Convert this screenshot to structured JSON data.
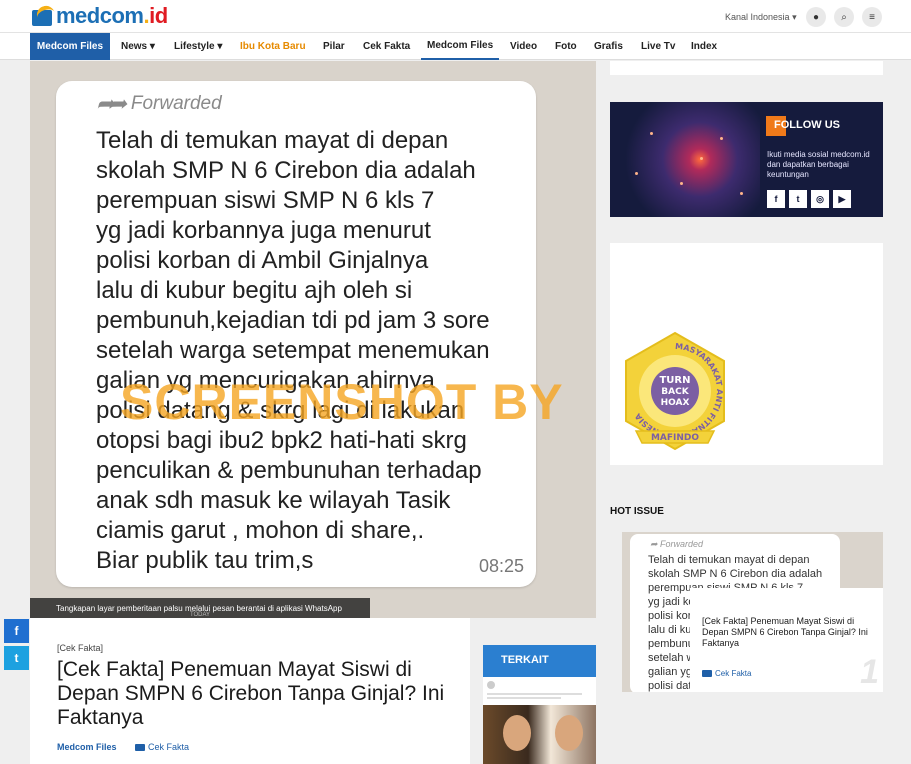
{
  "header": {
    "logo_main": "medcom",
    "logo_dot": ".",
    "logo_tld": "id",
    "kanal_label": "Kanal Indonesia",
    "icons": [
      "user-icon",
      "search-icon",
      "menu-icon"
    ]
  },
  "nav": {
    "active": "Medcom Files",
    "items": [
      "News",
      "Lifestyle",
      "Ibu Kota Baru",
      "Pilar",
      "Cek Fakta",
      "Medcom Files",
      "Video",
      "Foto",
      "Grafis",
      "Live Tv",
      "Index"
    ]
  },
  "hero": {
    "forwarded_label": "Forwarded",
    "message_lines": [
      "Telah di temukan mayat di depan",
      "skolah SMP N 6 Cirebon dia adalah",
      "perempuan siswi SMP N 6 kls 7",
      "yg jadi korbannya juga menurut",
      "polisi korban di Ambil Ginjalnya",
      "lalu di kubur begitu ajh oleh si",
      "pembunuh,kejadian tdi pd jam 3 sore",
      "setelah warga setempat menemukan",
      "galian yg mencurigakan ahirnya",
      "polisi datang & skrg lagi di lakukan",
      "otopsi bagi ibu2 bpk2 hati-hati skrg",
      "penculikan & pembunuhan terhadap",
      "anak sdh masuk ke wilayah Tasik",
      "ciamis garut , mohon di share,.",
      "Biar publik tau trim,s"
    ],
    "time": "08:25",
    "watermark": "SCREENSHOT BY",
    "caption": "Tangkapan layar pemberitaan palsu melalui pesan berantai di aplikasi WhatsApp",
    "caption_tail": "TODAY"
  },
  "share": {
    "facebook": "f",
    "twitter": "t"
  },
  "article": {
    "kicker": "[Cek Fakta]",
    "title": "[Cek Fakta] Penemuan Mayat Siswi di Depan SMPN 6 Cirebon Tanpa Ginjal? Ini Faktanya",
    "author": "Medcom Files",
    "category": "Cek Fakta"
  },
  "terkait": {
    "label": "TERKAIT"
  },
  "sidebar": {
    "follow_title": "FOLLOW US",
    "follow_text": "Ikuti media sosial medcom.id dan dapatkan berbagai keuntungan",
    "follow_buttons": [
      "f",
      "t",
      "◎",
      "▶"
    ],
    "mafindo": {
      "ring_text": "MASYARAKAT ANTI FITNAH INDONESIA",
      "center_line1": "TURN",
      "center_line2": "BACK",
      "center_line3": "HOAX",
      "banner": "MAFINDO"
    },
    "hot_issue_title": "HOT ISSUE",
    "hot_issue": {
      "forwarded_label": "Forwarded",
      "image_lines": [
        "Telah di temukan mayat di depan",
        "skolah SMP N 6 Cirebon dia adalah",
        "perempuan siswi SMP N 6 kls 7",
        "yg jadi korba",
        "polisi korb",
        "lalu di kub",
        "pembunu",
        "setelah w",
        "galian yg",
        "polisi data"
      ],
      "title": "[Cek Fakta] Penemuan Mayat Siswi di Depan SMPN 6 Cirebon Tanpa Ginjal? Ini Faktanya",
      "category": "Cek Fakta",
      "rank": "1"
    }
  },
  "colors": {
    "brand_blue": "#1c6fb5",
    "nav_active": "#1f5fa8",
    "accent_orange": "#e68a00",
    "follow_bg": "#151b3d"
  }
}
